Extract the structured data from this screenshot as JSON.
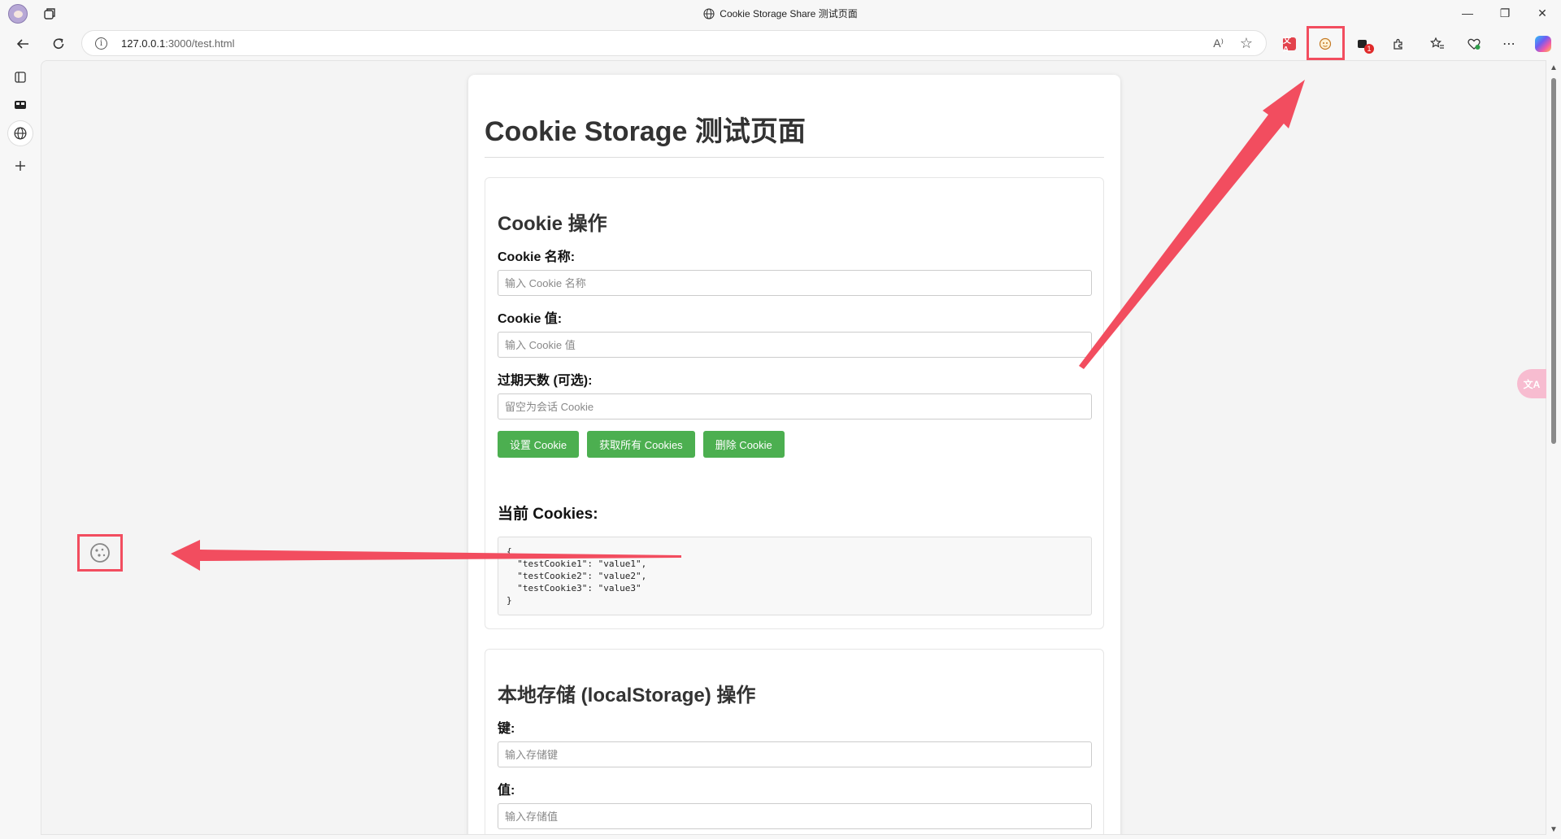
{
  "window": {
    "title": "Cookie Storage Share 测试页面",
    "minimize": "—",
    "restore": "❐",
    "close": "✕"
  },
  "address_bar": {
    "url_host": "127.0.0.1",
    "url_rest": ":3000/test.html",
    "info_glyph": "i",
    "read_aloud_glyph": "A⁾",
    "favorite_glyph": "☆"
  },
  "toolbar": {
    "extension_badge_count": "1",
    "translate_ext_label": "文A",
    "more_glyph": "⋯"
  },
  "page": {
    "title": "Cookie Storage 测试页面",
    "cookie_section": {
      "heading": "Cookie 操作",
      "name_label": "Cookie 名称:",
      "name_placeholder": "输入 Cookie 名称",
      "value_label": "Cookie 值:",
      "value_placeholder": "输入 Cookie 值",
      "expire_label": "过期天数 (可选):",
      "expire_placeholder": "留空为会话 Cookie",
      "buttons": {
        "set": "设置 Cookie",
        "get_all": "获取所有 Cookies",
        "delete": "删除 Cookie"
      },
      "current_title": "当前 Cookies:",
      "current_content": "{\n  \"testCookie1\": \"value1\",\n  \"testCookie2\": \"value2\",\n  \"testCookie3\": \"value3\"\n}"
    },
    "local_section": {
      "heading": "本地存储 (localStorage) 操作",
      "key_label": "键:",
      "key_placeholder": "输入存储键",
      "value_label": "值:",
      "value_placeholder": "输入存储值"
    }
  },
  "floating": {
    "translate_label": "文A"
  },
  "colors": {
    "accent_button": "#4caf50",
    "annotation": "#f24d5f",
    "browser_chrome": "#f7f7f7"
  }
}
